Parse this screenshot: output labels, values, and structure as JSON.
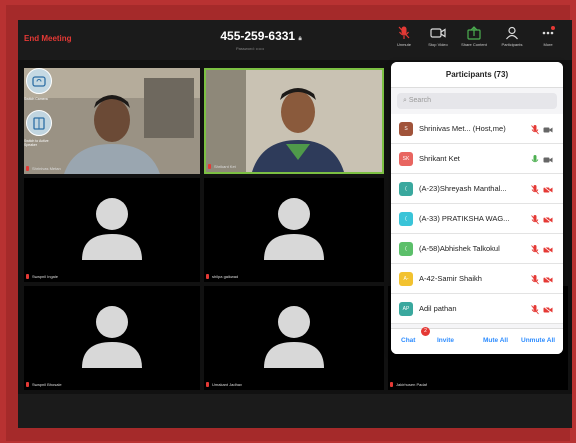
{
  "topbar": {
    "end_meeting": "End Meeting",
    "meeting_id": "455-259-6331",
    "password_label": "Password: ••••••",
    "buttons": [
      {
        "label": "Unmute",
        "icon": "mic-off-icon"
      },
      {
        "label": "Stop Video",
        "icon": "video-icon"
      },
      {
        "label": "Share Content",
        "icon": "share-icon"
      },
      {
        "label": "Participants",
        "icon": "participants-icon"
      },
      {
        "label": "More",
        "icon": "more-icon"
      }
    ]
  },
  "side_controls": [
    {
      "label": "Switch Camera",
      "icon": "camera-switch-icon"
    },
    {
      "label": "Switch to Active Speaker",
      "icon": "speaker-view-icon"
    }
  ],
  "tiles": [
    {
      "name": "Shrinivas Metan",
      "video": true
    },
    {
      "name": "Shrikant Ket",
      "video": true
    },
    {
      "name": "Swapnil Ingale",
      "video": false
    },
    {
      "name": "shilpa gaikwad",
      "video": false
    },
    {
      "name": "Swapnil Bhosale",
      "video": false
    },
    {
      "name": "Umakant Jadhav",
      "video": false
    },
    {
      "name": "Jakirhusen Padaf",
      "video": false
    }
  ],
  "participants_panel": {
    "title": "Participants (73)",
    "search_placeholder": "Search",
    "participants": [
      {
        "initial": "S",
        "name": "Shrinivas Met... (Host,me)",
        "color": "#a0533a",
        "mic": "muted",
        "video": "on"
      },
      {
        "initial": "SK",
        "name": "Shrikant Ket",
        "color": "#e86560",
        "mic": "on",
        "video": "on"
      },
      {
        "initial": "(",
        "name": "(A-23)Shreyash Manthal...",
        "color": "#3aa89e",
        "mic": "muted",
        "video": "off"
      },
      {
        "initial": "(",
        "name": "(A-33) PRATIKSHA WAG...",
        "color": "#3ac4d8",
        "mic": "muted",
        "video": "off"
      },
      {
        "initial": "(",
        "name": "(A-58)Abhishek Talkokul",
        "color": "#5cbf6a",
        "mic": "muted",
        "video": "off"
      },
      {
        "initial": "A-",
        "name": "A-42-Samir Shaikh",
        "color": "#f2c230",
        "mic": "muted",
        "video": "off"
      },
      {
        "initial": "AP",
        "name": "Adil pathan",
        "color": "#3aa89e",
        "mic": "muted",
        "video": "off"
      }
    ],
    "footer": {
      "chat": "Chat",
      "chat_badge": "2",
      "invite": "Invite",
      "mute_all": "Mute All",
      "unmute_all": "Unmute All"
    }
  },
  "colors": {
    "accent": "#2d8cff",
    "danger": "#e53935",
    "active_speaker_border": "#7cc043"
  }
}
